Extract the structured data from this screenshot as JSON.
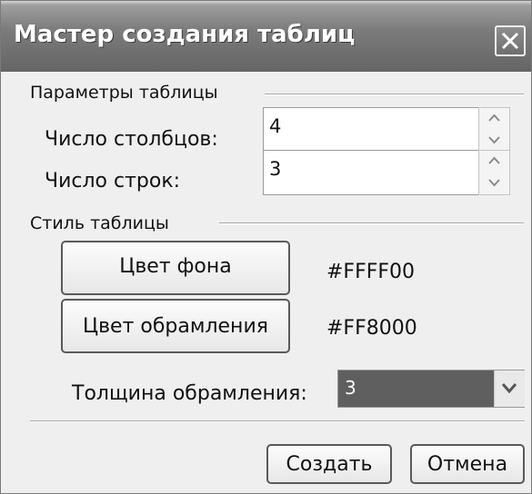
{
  "window": {
    "title": "Мастер создания таблиц"
  },
  "table_params": {
    "group_title": "Параметры таблицы",
    "columns_label": "Число столбцов:",
    "columns_value": "4",
    "rows_label": "Число строк:",
    "rows_value": "3"
  },
  "table_style": {
    "group_title": "Стиль таблицы",
    "bg_color_button": "Цвет фона",
    "bg_color_value": "#FFFF00",
    "border_color_button": "Цвет обрамления",
    "border_color_value": "#FF8000",
    "border_width_label": "Толщина обрамления:",
    "border_width_value": "3"
  },
  "buttons": {
    "create": "Создать",
    "cancel": "Отмена"
  },
  "icons": {
    "close": "close-icon",
    "spin_up": "chevron-up-icon",
    "spin_down": "chevron-down-icon",
    "dropdown": "chevron-down-icon"
  }
}
